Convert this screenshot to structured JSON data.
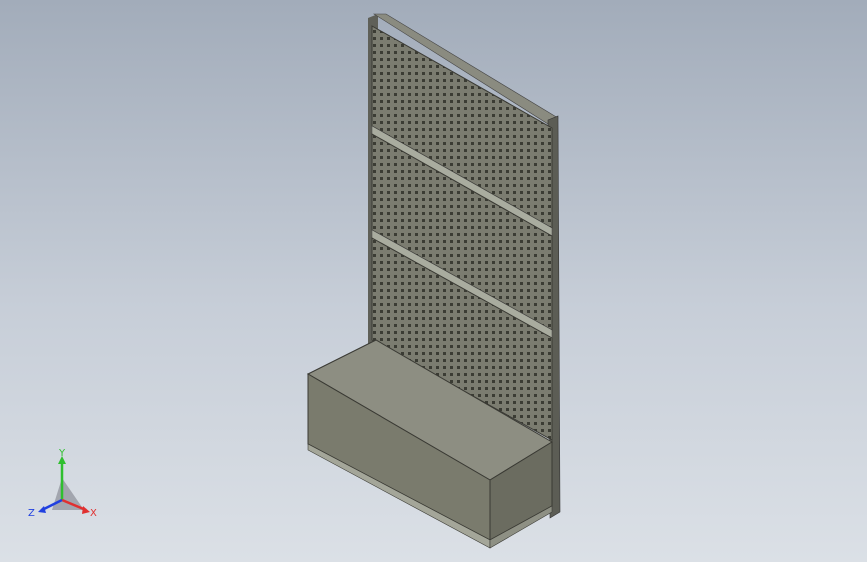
{
  "viewport": {
    "background_top": "#a2acba",
    "background_bottom": "#dbe0e6"
  },
  "model": {
    "panel_color": "#7b7c70",
    "hole_color": "#3b3c34",
    "frame_color": "#6f7066",
    "cabinet_top_color": "#8d8e82",
    "cabinet_front_color": "#7a7b6d",
    "cabinet_side_color": "#6b6c60"
  },
  "triad": {
    "y_label": "Y",
    "x_label": "X",
    "z_label": "Z",
    "y_color": "#2fbf2f",
    "x_color": "#e03030",
    "z_color": "#2040e0"
  }
}
